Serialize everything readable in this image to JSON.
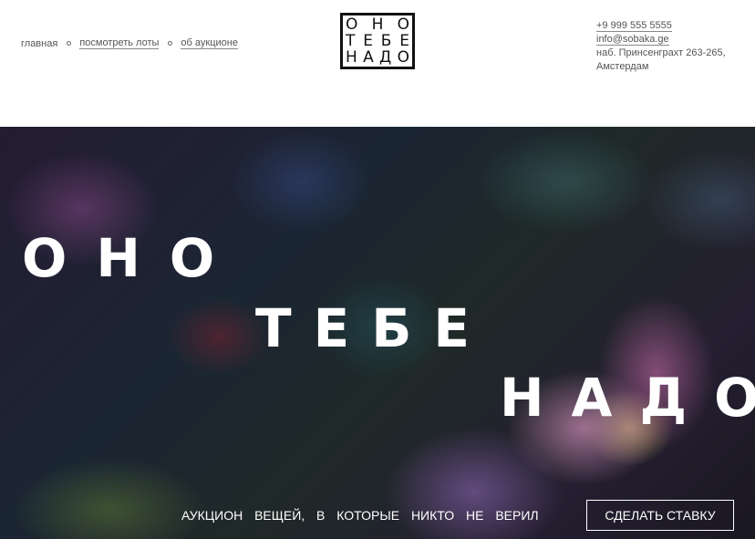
{
  "nav": {
    "items": [
      {
        "label": "главная"
      },
      {
        "label": "посмотреть лоты"
      },
      {
        "label": "об аукционе"
      }
    ]
  },
  "logo": {
    "rows": [
      [
        "О",
        "Н",
        "О"
      ],
      [
        "Т",
        "Е",
        "Б",
        "Е"
      ],
      [
        "Н",
        "А",
        "Д",
        "О"
      ]
    ]
  },
  "contacts": {
    "phone": "+9 999 555 5555",
    "email": "info@sobaka.ge",
    "address_line1": "наб. Принсенграхт 263-265,",
    "address_line2": "Амстердам"
  },
  "hero": {
    "word1": [
      "О",
      "Н",
      "О"
    ],
    "word2": [
      "Т",
      "Е",
      "Б",
      "Е"
    ],
    "word3": [
      "Н",
      "А",
      "Д",
      "О"
    ],
    "tagline": "аукцион вещей, в которые никто не верил",
    "cta_label": "сделать ставку"
  },
  "colors": {
    "text": "#555555",
    "logo_border": "#111111",
    "hero_text": "#ffffff"
  }
}
